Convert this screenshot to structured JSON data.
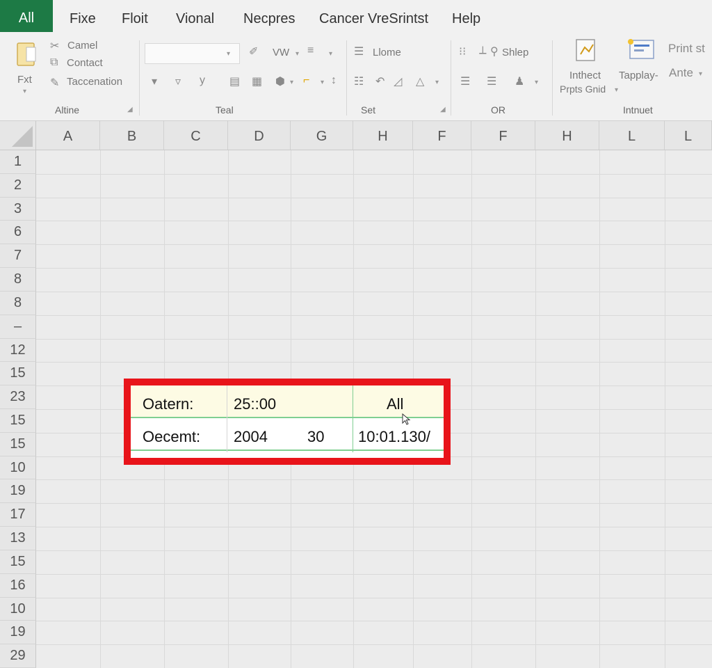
{
  "menu": {
    "tabs": [
      "All",
      "Fixe",
      "Floit",
      "Vional",
      "Necpres",
      "Cancer VreSrintst",
      "Help"
    ]
  },
  "ribbon": {
    "clipboard": {
      "paste_label": "Fxt",
      "items": [
        "Camel",
        "Contact",
        "Taccenation"
      ],
      "group_label": "Altine"
    },
    "font": {
      "format_label": "VW",
      "group_label": "Teal"
    },
    "alignment": {
      "wrap_label": "Llome",
      "group_label": "Set"
    },
    "styles": {
      "shape_label": "Shlep",
      "group_label": "OR"
    },
    "insert": {
      "btn1_line1": "Inthect",
      "btn1_line2": "Prpts Gnid",
      "btn2_label": "Tapplay-",
      "print_label": "Print st",
      "ante_label": "Ante",
      "group_label": "Intnuet"
    }
  },
  "grid": {
    "columns": [
      "A",
      "B",
      "C",
      "D",
      "G",
      "H",
      "F",
      "F",
      "H",
      "L",
      "L"
    ],
    "rows": [
      "1",
      "2",
      "3",
      "6",
      "7",
      "8",
      "8",
      "–",
      "12",
      "15",
      "23",
      "15",
      "15",
      "10",
      "19",
      "17",
      "13",
      "15",
      "16",
      "10",
      "19",
      "29"
    ]
  },
  "highlight": {
    "row1": {
      "label": "Oatern:",
      "value": "25::00",
      "right": "All"
    },
    "row2": {
      "label": "Oecemt:",
      "value1": "2004",
      "value2": "30",
      "right": "10:01.130/"
    },
    "border_color": "#e8141a"
  },
  "colors": {
    "accent": "#1d7a45"
  }
}
